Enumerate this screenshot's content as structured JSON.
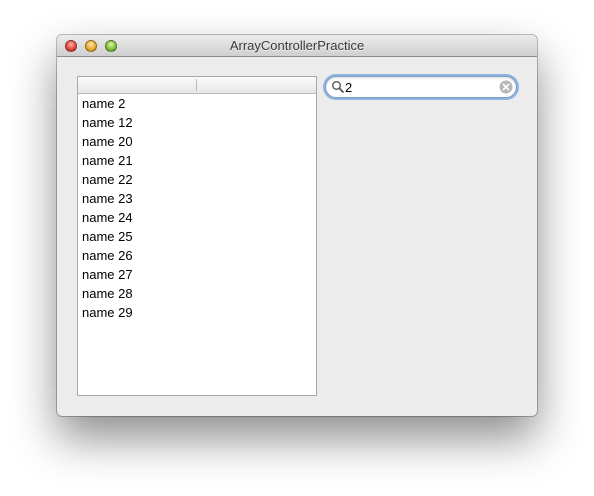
{
  "window": {
    "title": "ArrayControllerPractice"
  },
  "table": {
    "columns": [
      "",
      ""
    ],
    "rows": [
      "name 2",
      "name 12",
      "name 20",
      "name 21",
      "name 22",
      "name 23",
      "name 24",
      "name 25",
      "name 26",
      "name 27",
      "name 28",
      "name 29"
    ]
  },
  "search": {
    "value": "2",
    "icon": "magnifier-icon",
    "clear_icon": "clear-circle-x-icon"
  },
  "colors": {
    "focus_ring": "#8fb3e0",
    "close": "#e0443e",
    "minimize": "#e7a92c",
    "zoom": "#7fbf3a"
  }
}
